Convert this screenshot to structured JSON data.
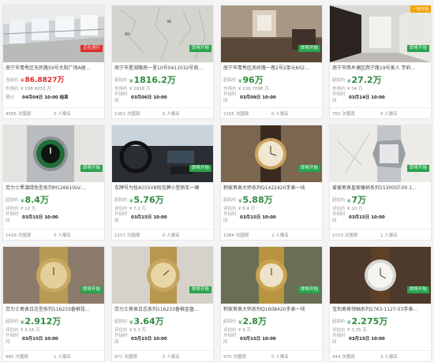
{
  "items": [
    {
      "title": "南宁市青秀区东民路59号大阳广场A座…",
      "price_label": "当前价",
      "price": "86.8827",
      "price_unit": "万",
      "market_label": "市场价",
      "market": "¥ 108.6033 万",
      "time_label": "预计",
      "time": "04月04日 10:00 结束",
      "button": "正在进行",
      "views": "4585",
      "views_label": "次围观",
      "signups": "0",
      "signups_label": "人报名",
      "price_red": true
    },
    {
      "title": "南宁市星湖路南一里10号0411032号商…",
      "price_label": "起拍价",
      "price": "1816.2",
      "price_unit": "万",
      "market_label": "市场价",
      "market": "¥ 2018 万",
      "time_label": "开拍时间",
      "time": "03月06日 10:00",
      "button": "即将开始",
      "views": "1063",
      "views_label": "次围观",
      "signups": "0",
      "signups_label": "人报名"
    },
    {
      "title": "南宁市青秀区凤岭路一巷2号2单元602…",
      "price_label": "起拍价",
      "price": "96",
      "price_unit": "万",
      "market_label": "市场价",
      "market": "¥ 136.7098 万",
      "time_label": "开拍时间",
      "time": "03月09日 10:00",
      "button": "即将开始",
      "views": "2105",
      "views_label": "次围观",
      "signups": "0",
      "signups_label": "人报名"
    },
    {
      "title": "南宁市西乡塘区西宁路19号美人 学府…",
      "price_label": "起拍价",
      "price": "27.2",
      "price_unit": "万",
      "market_label": "市场价",
      "market": "¥ 34 万",
      "time_label": "开拍时间",
      "time": "03月14日 10:00",
      "button": "即将开始",
      "views": "765",
      "views_label": "次围观",
      "signups": "0",
      "signups_label": "人报名",
      "ribbon": "一拍开拍"
    },
    {
      "title": "劳力士黑潜绿色型系列M126610LV-…",
      "price_label": "起拍价",
      "price": "8.4",
      "price_unit": "万",
      "market_label": "评估价",
      "market": "¥ 12 万",
      "time_label": "开拍时间",
      "time": "03月15日 10:00",
      "button": "即将开始",
      "views": "1428",
      "views_label": "次围观",
      "signups": "0",
      "signups_label": "人报名"
    },
    {
      "title": "车牌号为桂A555V8别克牌小型轿车一辆",
      "price_label": "起拍价",
      "price": "5.76",
      "price_unit": "万",
      "market_label": "评估价",
      "market": "¥ 7.2 万",
      "time_label": "开拍时间",
      "time": "03月15日 10:00",
      "button": "即将开始",
      "views": "1157",
      "views_label": "次围观",
      "signups": "0",
      "signups_label": "人报名"
    },
    {
      "title": "积家男表大师系列Q1422420手表一块",
      "price_label": "起拍价",
      "price": "5.88",
      "price_unit": "万",
      "market_label": "评估价",
      "market": "¥ 8.4 万",
      "time_label": "开拍时间",
      "time": "03月15日 10:00",
      "button": "即将开始",
      "views": "1084",
      "views_label": "次围观",
      "signups": "2",
      "signups_label": "人报名"
    },
    {
      "title": "爱彼男表皇家橡树系列15300ST.00.1…",
      "price_label": "起拍价",
      "price": "7",
      "price_unit": "万",
      "market_label": "评估价",
      "market": "¥ 10 万",
      "time_label": "开拍时间",
      "time": "03月15日 10:00",
      "button": "即将开始",
      "views": "1010",
      "views_label": "次围观",
      "signups": "1",
      "signups_label": "人报名"
    },
    {
      "title": "劳力士男表日志型系列116233香槟花…",
      "price_label": "起拍价",
      "price": "2.912",
      "price_unit": "万",
      "market_label": "评估价",
      "market": "¥ 4.16 万",
      "time_label": "开拍时间",
      "time": "03月15日 10:00",
      "button": "即将开始",
      "views": "980",
      "views_label": "次围观",
      "signups": "1",
      "signups_label": "人报名"
    },
    {
      "title": "劳力士男表日志系列116233香槟金盘…",
      "price_label": "起拍价",
      "price": "3.64",
      "price_unit": "万",
      "market_label": "评估价",
      "market": "¥ 5.2 万",
      "time_label": "开拍时间",
      "time": "03月15日 10:00",
      "button": "即将开始",
      "views": "971",
      "views_label": "次围观",
      "signups": "0",
      "signups_label": "人报名"
    },
    {
      "title": "积家男表大师系列Q1608420手表一块",
      "price_label": "起拍价",
      "price": "2.8",
      "price_unit": "万",
      "market_label": "评估价",
      "market": "¥ 4 万",
      "time_label": "开拍时间",
      "time": "03月15日 10:00",
      "button": "即将开始",
      "views": "970",
      "views_label": "次围观",
      "signups": "0",
      "signups_label": "人报名"
    },
    {
      "title": "宝珀男表领袖系列2763-1127-53手表…",
      "price_label": "起拍价",
      "price": "2.275",
      "price_unit": "万",
      "market_label": "评估价",
      "market": "¥ 3.25 万",
      "time_label": "开拍时间",
      "time": "03月15日 10:00",
      "button": "即将开始",
      "views": "944",
      "views_label": "次围观",
      "signups": "3",
      "signups_label": "人报名"
    }
  ],
  "currency": "¥",
  "colors": {
    "accent": "#27a34c",
    "price": "#2e8b3e",
    "alert": "#e02a2a",
    "ribbon": "#f3a200"
  }
}
